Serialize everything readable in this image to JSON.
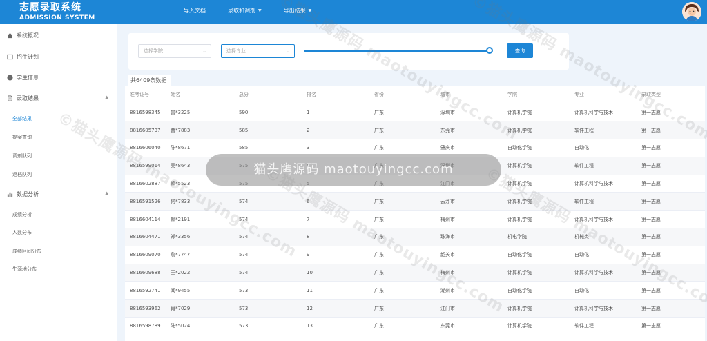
{
  "app": {
    "title_cn": "志愿录取系统",
    "title_en": "ADMISSION SYSTEM"
  },
  "nav": [
    {
      "label": "导入文档",
      "has_caret": false
    },
    {
      "label": "录取和调剂",
      "has_caret": true
    },
    {
      "label": "导出结果",
      "has_caret": true
    }
  ],
  "sidebar": {
    "items": [
      {
        "label": "系统概况",
        "icon": "home-icon"
      },
      {
        "label": "招生计划",
        "icon": "book-icon"
      },
      {
        "label": "学生信息",
        "icon": "info-icon"
      },
      {
        "label": "录取结果",
        "icon": "document-icon"
      }
    ],
    "result_subs": [
      {
        "label": "全部结果",
        "active": true
      },
      {
        "label": "提案查询",
        "active": false
      },
      {
        "label": "调剂队列",
        "active": false
      },
      {
        "label": "退档队列",
        "active": false
      }
    ],
    "analysis": {
      "label": "数据分析",
      "icon": "chart-icon"
    },
    "analysis_subs": [
      {
        "label": "成绩分析"
      },
      {
        "label": "人数分布"
      },
      {
        "label": "成绩区间分布"
      },
      {
        "label": "生源地分布"
      }
    ]
  },
  "filter": {
    "college_placeholder": "选择学院",
    "major_placeholder": "选择专业",
    "slider_value_percent": 100,
    "query_label": "查询"
  },
  "table": {
    "count_label": "共6409条数据",
    "columns": [
      "准考证号",
      "姓名",
      "总分",
      "排名",
      "省份",
      "城市",
      "学院",
      "专业",
      "录取类型"
    ],
    "rows": [
      [
        "8816598345",
        "曾*3225",
        "590",
        "1",
        "广东",
        "深圳市",
        "计算机学院",
        "计算机科学与技术",
        "第一志愿"
      ],
      [
        "8816605737",
        "曹*7883",
        "585",
        "2",
        "广东",
        "东莞市",
        "计算机学院",
        "软件工程",
        "第一志愿"
      ],
      [
        "8816606040",
        "陈*8671",
        "585",
        "3",
        "广东",
        "肇庆市",
        "自动化学院",
        "自动化",
        "第一志愿"
      ],
      [
        "8816599014",
        "吴*8643",
        "575",
        "4",
        "广东",
        "深圳市",
        "计算机学院",
        "软件工程",
        "第一志愿"
      ],
      [
        "8816602887",
        "赖*5523",
        "575",
        "5",
        "广东",
        "江门市",
        "计算机学院",
        "计算机科学与技术",
        "第一志愿"
      ],
      [
        "8816591526",
        "何*7833",
        "574",
        "6",
        "广东",
        "云浮市",
        "计算机学院",
        "软件工程",
        "第一志愿"
      ],
      [
        "8816604114",
        "赖*2191",
        "574",
        "7",
        "广东",
        "梅州市",
        "计算机学院",
        "计算机科学与技术",
        "第一志愿"
      ],
      [
        "8816604471",
        "郑*3356",
        "574",
        "8",
        "广东",
        "珠海市",
        "机电学院",
        "机械类",
        "第一志愿"
      ],
      [
        "8816609070",
        "詹*7747",
        "574",
        "9",
        "广东",
        "韶关市",
        "自动化学院",
        "自动化",
        "第一志愿"
      ],
      [
        "8816609688",
        "王*2022",
        "574",
        "10",
        "广东",
        "梅州市",
        "计算机学院",
        "计算机科学与技术",
        "第一志愿"
      ],
      [
        "8816592741",
        "闻*9455",
        "573",
        "11",
        "广东",
        "潮州市",
        "自动化学院",
        "自动化",
        "第一志愿"
      ],
      [
        "8816593962",
        "肖*7029",
        "573",
        "12",
        "广东",
        "江门市",
        "计算机学院",
        "计算机科学与技术",
        "第一志愿"
      ],
      [
        "8816598789",
        "陆*5024",
        "573",
        "13",
        "广东",
        "东莞市",
        "计算机学院",
        "软件工程",
        "第一志愿"
      ]
    ]
  },
  "watermark": {
    "text": "©猫头鹰源码 maotouyingcc.com",
    "badge": "猫头鹰源码 maotouyingcc.com"
  },
  "colors": {
    "primary": "#1d86d6",
    "background": "#eef4fb"
  }
}
